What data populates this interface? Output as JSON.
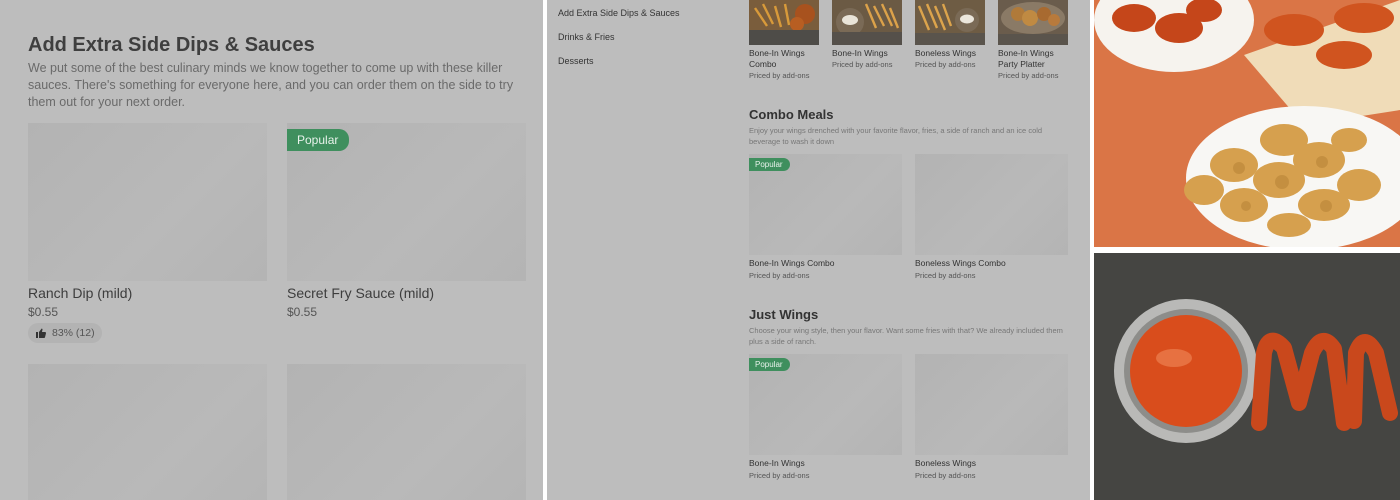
{
  "left": {
    "title": "Add Extra Side Dips & Sauces",
    "description": "We put some of the best culinary minds we know together to come up with these killer sauces. There's something for everyone here, and you can order them on the side to try them out for your next order.",
    "cards": [
      {
        "name": "Ranch Dip (mild)",
        "price": "$0.55",
        "rating": "83% (12)"
      },
      {
        "name": "Secret Fry Sauce (mild)",
        "price": "$0.55",
        "badge": "Popular"
      }
    ]
  },
  "mid": {
    "nav": [
      "Add Extra Side Dips & Sauces",
      "Drinks & Fries",
      "Desserts"
    ],
    "top_items": [
      {
        "name": "Bone-In Wings Combo",
        "price": "Priced by add-ons"
      },
      {
        "name": "Bone-In Wings",
        "price": "Priced by add-ons"
      },
      {
        "name": "Boneless Wings",
        "price": "Priced by add-ons"
      },
      {
        "name": "Bone-In Wings Party Platter",
        "price": "Priced by add-ons"
      }
    ],
    "sections": [
      {
        "title": "Combo Meals",
        "description": "Enjoy your wings drenched with your favorite flavor, fries, a side of ranch and an ice cold beverage to wash it down",
        "items": [
          {
            "name": "Bone-In Wings Combo",
            "price": "Priced by add-ons",
            "badge": "Popular"
          },
          {
            "name": "Boneless Wings Combo",
            "price": "Priced by add-ons"
          }
        ]
      },
      {
        "title": "Just Wings",
        "description": "Choose your wing style, then your flavor. Want some fries with that? We already included them plus a side of ranch.",
        "items": [
          {
            "name": "Bone-In Wings",
            "price": "Priced by add-ons",
            "badge": "Popular"
          },
          {
            "name": "Boneless Wings",
            "price": "Priced by add-ons"
          }
        ]
      }
    ]
  },
  "colors": {
    "overlay": "#bdbdbd",
    "badge": "#3f8f5e",
    "orange_bg": "#e07a4a",
    "slate_bg": "#3c3c3a",
    "sauce": "#d94d1c"
  }
}
